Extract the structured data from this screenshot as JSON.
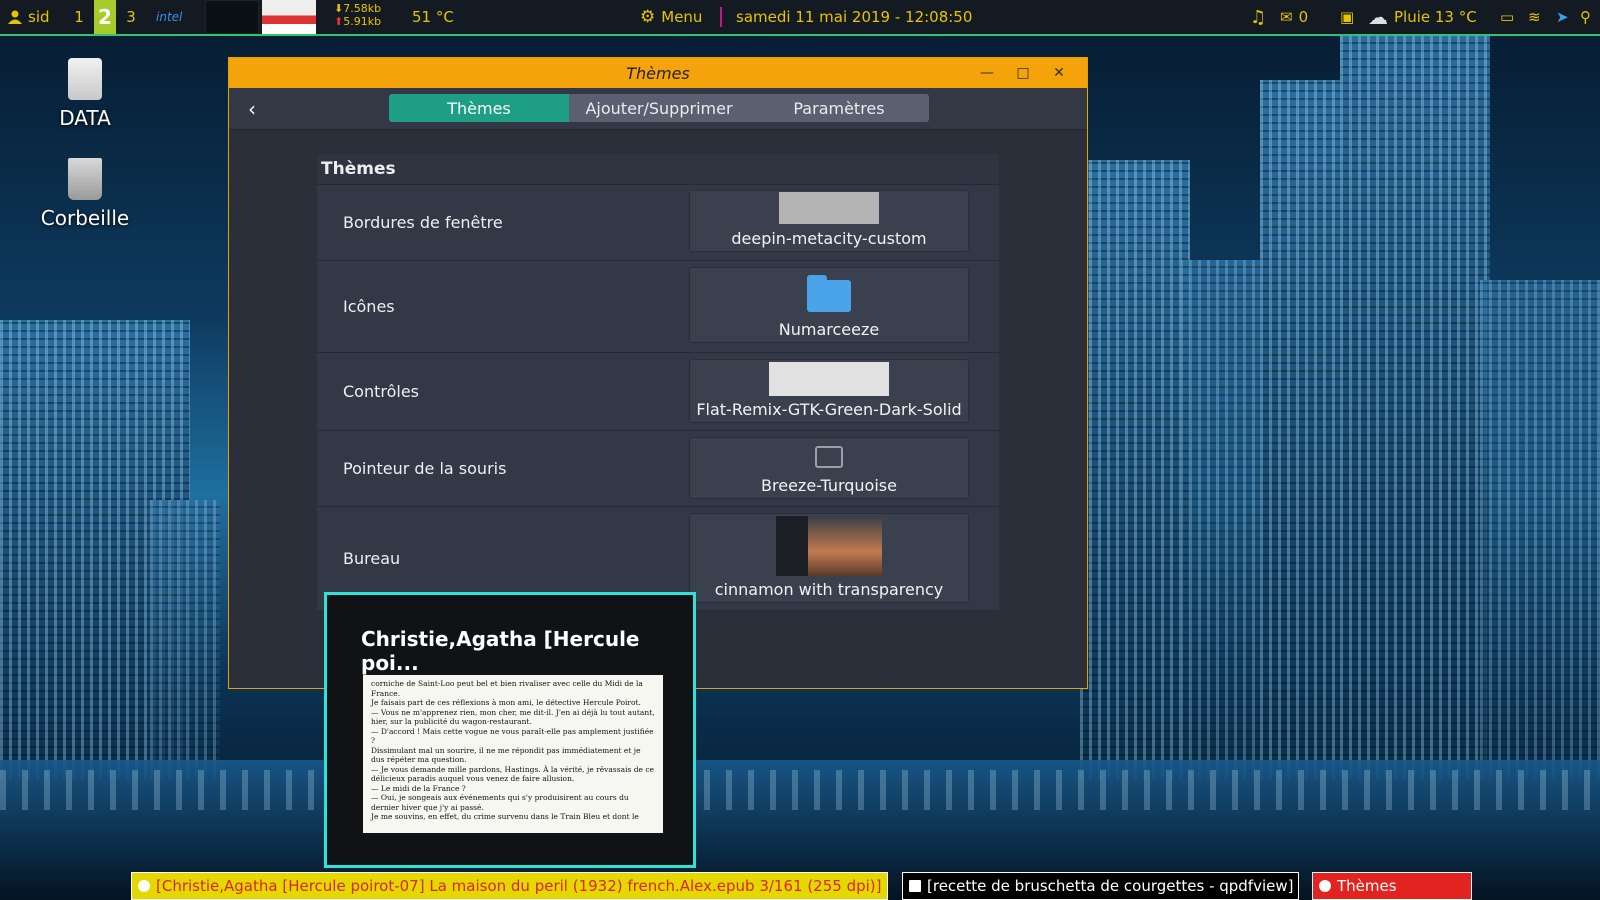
{
  "top_panel": {
    "user": "sid",
    "workspaces": [
      "1",
      "2",
      "3"
    ],
    "active_workspace": "2",
    "cpu_brand": "intel",
    "net_down": "7.58kb",
    "net_up": "5.91kb",
    "temperature": "51 °C",
    "menu_label": "Menu",
    "datetime": "samedi 11 mai 2019 - 12:08:50",
    "mail_count": "0",
    "weather": "Pluie 13 °C"
  },
  "desktop_icons": [
    {
      "label": "DATA",
      "icon": "drive-icon"
    },
    {
      "label": "Corbeille",
      "icon": "trash-icon"
    }
  ],
  "window": {
    "title": "Thèmes",
    "tabs": [
      {
        "label": "Thèmes",
        "active": true
      },
      {
        "label": "Ajouter/Supprimer",
        "active": false
      },
      {
        "label": "Paramètres",
        "active": false
      }
    ],
    "section_title": "Thèmes",
    "rows": [
      {
        "label": "Bordures de fenêtre",
        "value": "deepin-metacity-custom"
      },
      {
        "label": "Icônes",
        "value": "Numarceeze"
      },
      {
        "label": "Contrôles",
        "value": "Flat-Remix-GTK-Green-Dark-Solid"
      },
      {
        "label": "Pointeur de la souris",
        "value": "Breeze-Turquoise"
      },
      {
        "label": "Bureau",
        "value": "cinnamon with transparency"
      }
    ]
  },
  "preview": {
    "title": "Christie,Agatha [Hercule poi...",
    "page_lines": [
      "corniche de Saint-Loo peut bel et bien rivaliser avec celle du Midi de la France.",
      "Je faisais part de ces réflexions à mon ami, le détective Hercule Poirot.",
      "— Vous ne m'apprenez rien, mon cher, me dit-il. J'en ai déjà lu tout autant, hier, sur la publicité du wagon-restaurant.",
      "— D'accord ! Mais cette vogue ne vous paraît-elle pas amplement justifiée ?",
      "Dissimulant mal un sourire, il ne me répondit pas immédiatement et je dus répéter ma question.",
      "— Je vous demande mille pardons, Hastings. À la vérité, je rêvassais de ce délicieux paradis auquel vous venez de faire allusion.",
      "— Le midi de la France ?",
      "— Oui, je songeais aux événements qui s'y produisirent au cours du dernier hiver que j'y ai passé.",
      "Je me souvins, en effet, du crime survenu dans le Train Bleu et dont le"
    ]
  },
  "taskbar": [
    {
      "label": "[Christie,Agatha [Hercule poirot-07] La maison du peril (1932) french.Alex.epub 3/161 (255 dpi)]"
    },
    {
      "label": "[recette de bruschetta de courgettes - qpdfview]"
    },
    {
      "label": "Thèmes"
    }
  ],
  "colors": {
    "titlebar": "#f5a30a",
    "active_tab": "#1e9e84",
    "panel_accent": "#e6c400",
    "preview_border": "#2ee3d6",
    "task_epub": "#e5d800",
    "task_themes": "#e3231f"
  }
}
